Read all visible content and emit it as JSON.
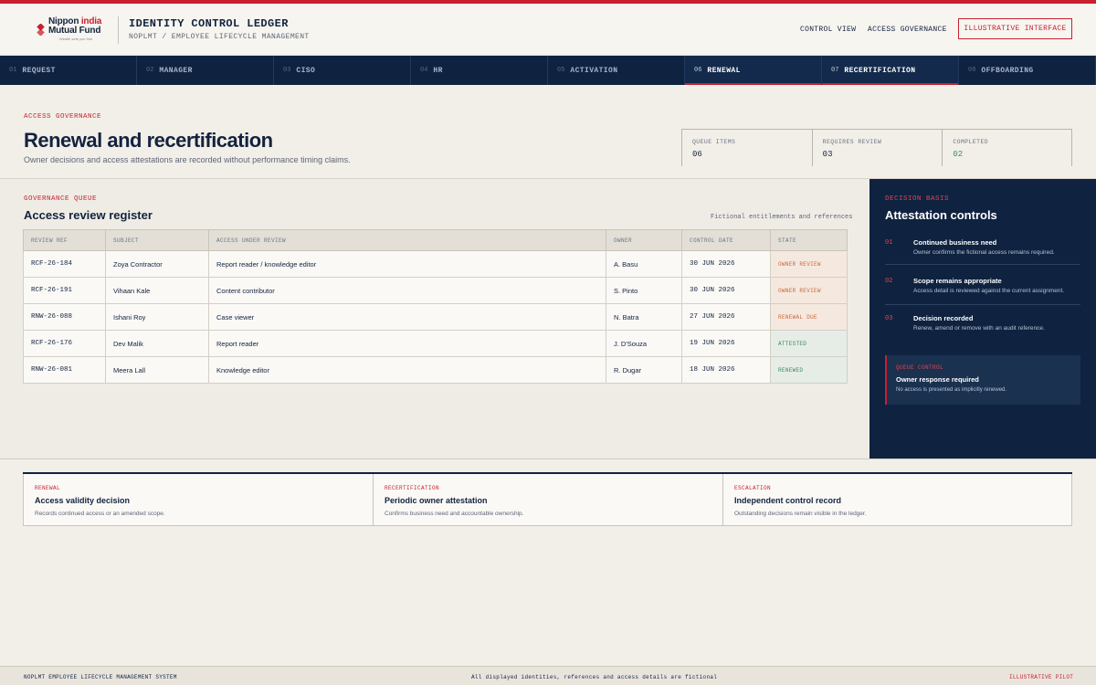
{
  "colors": {
    "brand_red": "#c8202f",
    "navy": "#0f2240",
    "warn": "#c86a3d",
    "ok": "#3f8a5d"
  },
  "logo": {
    "line1_a": "Nippon",
    "line1_b": "india",
    "line2": "Mutual Fund",
    "tagline": "Wealth sets you free"
  },
  "header": {
    "title": "IDENTITY CONTROL LEDGER",
    "subtitle": "NOPLMT / EMPLOYEE LIFECYCLE MANAGEMENT",
    "nav_control_view": "CONTROL VIEW",
    "nav_access_governance": "ACCESS GOVERNANCE",
    "badge": "ILLUSTRATIVE INTERFACE"
  },
  "steps": [
    {
      "num": "01",
      "label": "REQUEST"
    },
    {
      "num": "02",
      "label": "MANAGER"
    },
    {
      "num": "03",
      "label": "CISO"
    },
    {
      "num": "04",
      "label": "HR"
    },
    {
      "num": "05",
      "label": "ACTIVATION"
    },
    {
      "num": "06",
      "label": "RENEWAL"
    },
    {
      "num": "07",
      "label": "RECERTIFICATION"
    },
    {
      "num": "08",
      "label": "OFFBOARDING"
    }
  ],
  "page": {
    "eyebrow": "ACCESS GOVERNANCE",
    "title": "Renewal and recertification",
    "subtitle": "Owner decisions and access attestations are recorded without performance timing claims."
  },
  "stats": [
    {
      "label": "QUEUE ITEMS",
      "value": "06"
    },
    {
      "label": "REQUIRES REVIEW",
      "value": "03"
    },
    {
      "label": "COMPLETED",
      "value": "02"
    }
  ],
  "queue": {
    "eyebrow": "GOVERNANCE QUEUE",
    "title": "Access review register",
    "note": "Fictional entitlements and references",
    "columns": [
      "REVIEW REF",
      "SUBJECT",
      "ACCESS UNDER REVIEW",
      "OWNER",
      "CONTROL DATE",
      "STATE"
    ],
    "rows": [
      {
        "ref": "RCF-26-184",
        "subject": "Zoya Contractor",
        "access": "Report reader / knowledge editor",
        "owner": "A. Basu",
        "date": "30 JUN 2026",
        "state": "OWNER REVIEW",
        "kind": "warn"
      },
      {
        "ref": "RCF-26-191",
        "subject": "Vihaan Kale",
        "access": "Content contributor",
        "owner": "S. Pinto",
        "date": "30 JUN 2026",
        "state": "OWNER REVIEW",
        "kind": "warn"
      },
      {
        "ref": "RNW-26-088",
        "subject": "Ishani Roy",
        "access": "Case viewer",
        "owner": "N. Batra",
        "date": "27 JUN 2026",
        "state": "RENEWAL DUE",
        "kind": "warn"
      },
      {
        "ref": "RCF-26-176",
        "subject": "Dev Malik",
        "access": "Report reader",
        "owner": "J. D'Souza",
        "date": "19 JUN 2026",
        "state": "ATTESTED",
        "kind": "ok"
      },
      {
        "ref": "RNW-26-081",
        "subject": "Meera Lall",
        "access": "Knowledge editor",
        "owner": "R. Dugar",
        "date": "18 JUN 2026",
        "state": "RENEWED",
        "kind": "ok"
      }
    ]
  },
  "panel": {
    "eyebrow": "DECISION BASIS",
    "title": "Attestation controls",
    "controls": [
      {
        "num": "01",
        "title": "Continued business need",
        "desc": "Owner confirms the fictional access remains required."
      },
      {
        "num": "02",
        "title": "Scope remains appropriate",
        "desc": "Access detail is reviewed against the current assignment."
      },
      {
        "num": "03",
        "title": "Decision recorded",
        "desc": "Renew, amend or remove with an audit reference."
      }
    ],
    "queue_control": {
      "label": "QUEUE CONTROL",
      "title": "Owner response required",
      "desc": "No access is presented as implicitly renewed."
    }
  },
  "cards": [
    {
      "eyebrow": "RENEWAL",
      "title": "Access validity decision",
      "desc": "Records continued access or an amended scope."
    },
    {
      "eyebrow": "RECERTIFICATION",
      "title": "Periodic owner attestation",
      "desc": "Confirms business need and accountable ownership."
    },
    {
      "eyebrow": "ESCALATION",
      "title": "Independent control record",
      "desc": "Outstanding decisions remain visible in the ledger."
    }
  ],
  "footer": {
    "left": "NOPLMT EMPLOYEE LIFECYCLE MANAGEMENT SYSTEM",
    "center": "All displayed identities, references and access details are fictional",
    "right": "ILLUSTRATIVE PILOT"
  }
}
